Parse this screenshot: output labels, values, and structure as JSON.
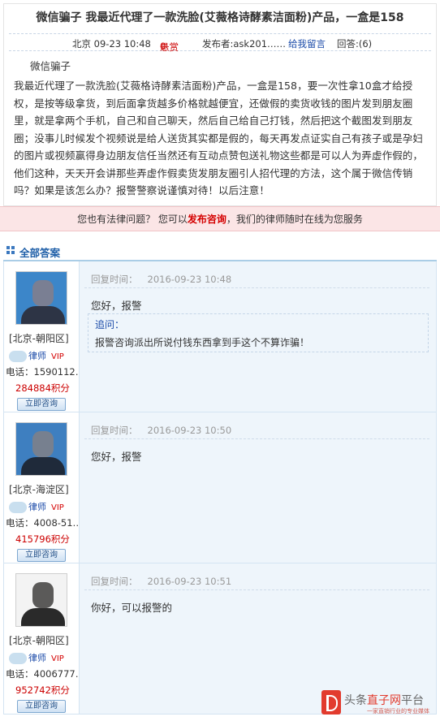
{
  "question": {
    "title": "微信骗子 我最近代理了一款洗脸(艾薇格诗酵素洁面粉)产品，一盒是158",
    "meta": {
      "city_time": "北京 09-23 10:48",
      "reward_label": "悬赏",
      "reward_value": "0",
      "poster": "发布者:ask201……",
      "message_link": "给我留言",
      "answers_count": "回答:(6)"
    },
    "intro": "微信骗子",
    "body": "我最近代理了一款洗脸(艾薇格诗酵素洁面粉)产品，一盒是158，要一次性拿10盒才给授权，是按等级拿货，到后面拿货越多价格就越便宜，还做假的卖货收钱的图片发到朋友圈里，就是拿两个手机，自己和自己聊天，然后自己给自己打钱，然后把这个截图发到朋友圈；没事儿时候发个视频说是给人送货其实都是假的，每天再发点证实自己有孩子或是孕妇的图片或视频赢得身边朋友信任当然还有互动点赞包送礼物这些都是可以人为弄虚作假的，他们这种，天天开会讲那些弄虚作假卖货发朋友圈引人招代理的方法，这个属于微信传销吗？如果是该怎么办？报警警察说谨慎对待！以后注意！"
  },
  "legal_bar": {
    "prefix": "您也有法律问题？  您可以",
    "link": "发布咨询",
    "suffix": "，我们的律师随时在线为您服务"
  },
  "answers_header": "全部答案",
  "answers": [
    {
      "region": "[北京-朝阳区]",
      "lawyer_title": "律师",
      "vip": "VIP",
      "phone": "电话：1590112…",
      "points": "284884积分",
      "consult_label": "立即咨询",
      "time_label": "回复时间：",
      "time_value": "2016-09-23 10:48",
      "reply": "您好，报警",
      "followup_label": "追问：",
      "followup_text": "报警咨询派出所说付钱东西拿到手这个不算诈骗！"
    },
    {
      "region": "[北京-海淀区]",
      "lawyer_title": "律师",
      "vip": "VIP",
      "phone": "电话：4008-51…",
      "points": "415796积分",
      "consult_label": "立即咨询",
      "time_label": "回复时间：",
      "time_value": "2016-09-23 10:50",
      "reply": "您好，报警"
    },
    {
      "region": "[北京-朝阳区]",
      "lawyer_title": "律师",
      "vip": "VIP",
      "phone": "电话：4006777…",
      "points": "952742积分",
      "consult_label": "立即咨询",
      "time_label": "回复时间：",
      "time_value": "2016-09-23 10:51",
      "reply": "你好，可以报警的"
    }
  ],
  "watermark": {
    "text_prefix": "头条",
    "text_red": "直子网",
    "text_suffix": "平台",
    "sub": "一家直销行业的专业媒体"
  }
}
